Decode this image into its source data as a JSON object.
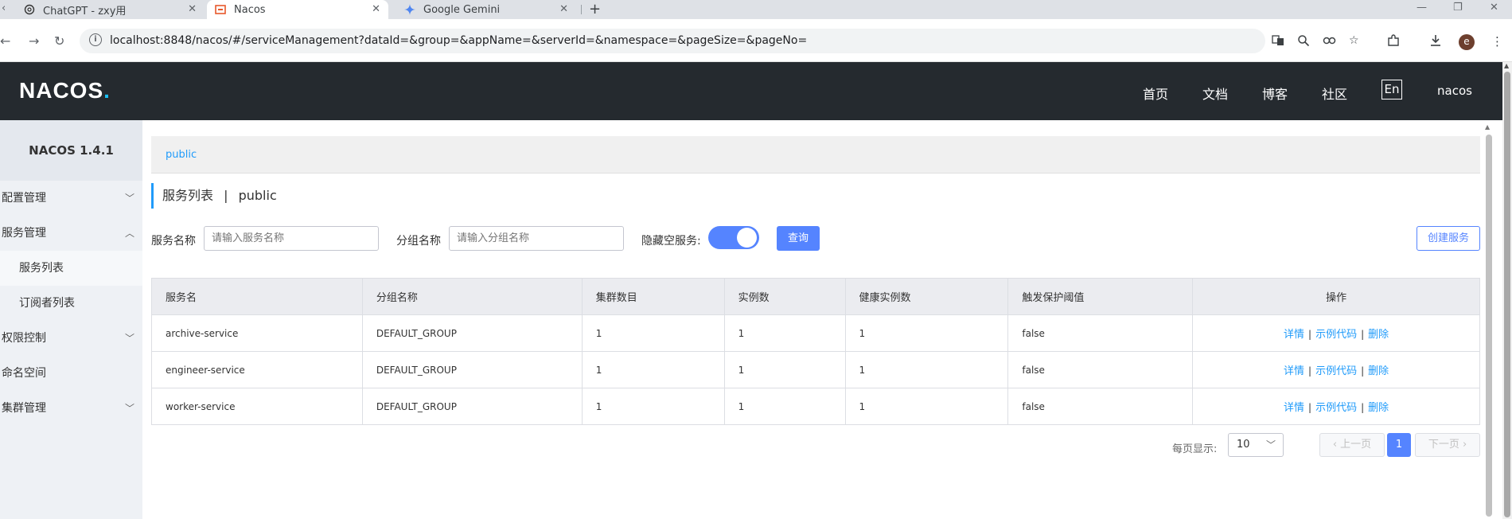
{
  "browser": {
    "tabs": [
      {
        "title": "ChatGPT - zxy用",
        "icon": "chatgpt-icon"
      },
      {
        "title": "Nacos",
        "icon": "nacos-icon"
      },
      {
        "title": "Google Gemini",
        "icon": "gemini-icon"
      }
    ],
    "new_tab": "+",
    "url": "localhost:8848/nacos/#/serviceManagement?dataId=&group=&appName=&serverId=&namespace=&pageSize=&pageNo=",
    "avatar_letter": "e"
  },
  "header": {
    "logo": "NACOS",
    "logo_dot": ".",
    "nav": [
      "首页",
      "文档",
      "博客",
      "社区"
    ],
    "lang_button": "En",
    "user": "nacos"
  },
  "sidebar": {
    "title": "NACOS 1.4.1",
    "items": [
      {
        "label": "配置管理"
      },
      {
        "label": "服务管理"
      },
      {
        "label": "服务列表"
      },
      {
        "label": "订阅者列表"
      },
      {
        "label": "权限控制"
      },
      {
        "label": "命名空间"
      },
      {
        "label": "集群管理"
      }
    ]
  },
  "main": {
    "namespace": "public",
    "title": "服务列表",
    "title_sep": "|",
    "title_ns": "public",
    "filters": {
      "service_name_label": "服务名称",
      "service_name_placeholder": "请输入服务名称",
      "group_name_label": "分组名称",
      "group_name_placeholder": "请输入分组名称",
      "hide_empty_label": "隐藏空服务:",
      "hide_empty_on": true,
      "query_button": "查询",
      "create_button": "创建服务"
    },
    "table": {
      "columns": [
        "服务名",
        "分组名称",
        "集群数目",
        "实例数",
        "健康实例数",
        "触发保护阈值",
        "操作"
      ],
      "rows": [
        {
          "name": "archive-service",
          "group": "DEFAULT_GROUP",
          "clusters": "1",
          "instances": "1",
          "healthy": "1",
          "threshold": "false"
        },
        {
          "name": "engineer-service",
          "group": "DEFAULT_GROUP",
          "clusters": "1",
          "instances": "1",
          "healthy": "1",
          "threshold": "false"
        },
        {
          "name": "worker-service",
          "group": "DEFAULT_GROUP",
          "clusters": "1",
          "instances": "1",
          "healthy": "1",
          "threshold": "false"
        }
      ],
      "ops": {
        "detail": "详情",
        "sample": "示例代码",
        "delete": "删除",
        "sep": "|"
      }
    },
    "pagination": {
      "per_page_label": "每页显示:",
      "page_size": "10",
      "prev": "上一页",
      "current_page": "1",
      "next": "下一页"
    }
  },
  "colors": {
    "primary": "#5584ff",
    "link": "#209bfa",
    "header_bg": "#252a2f",
    "sidebar_bg": "#eef1f5"
  }
}
